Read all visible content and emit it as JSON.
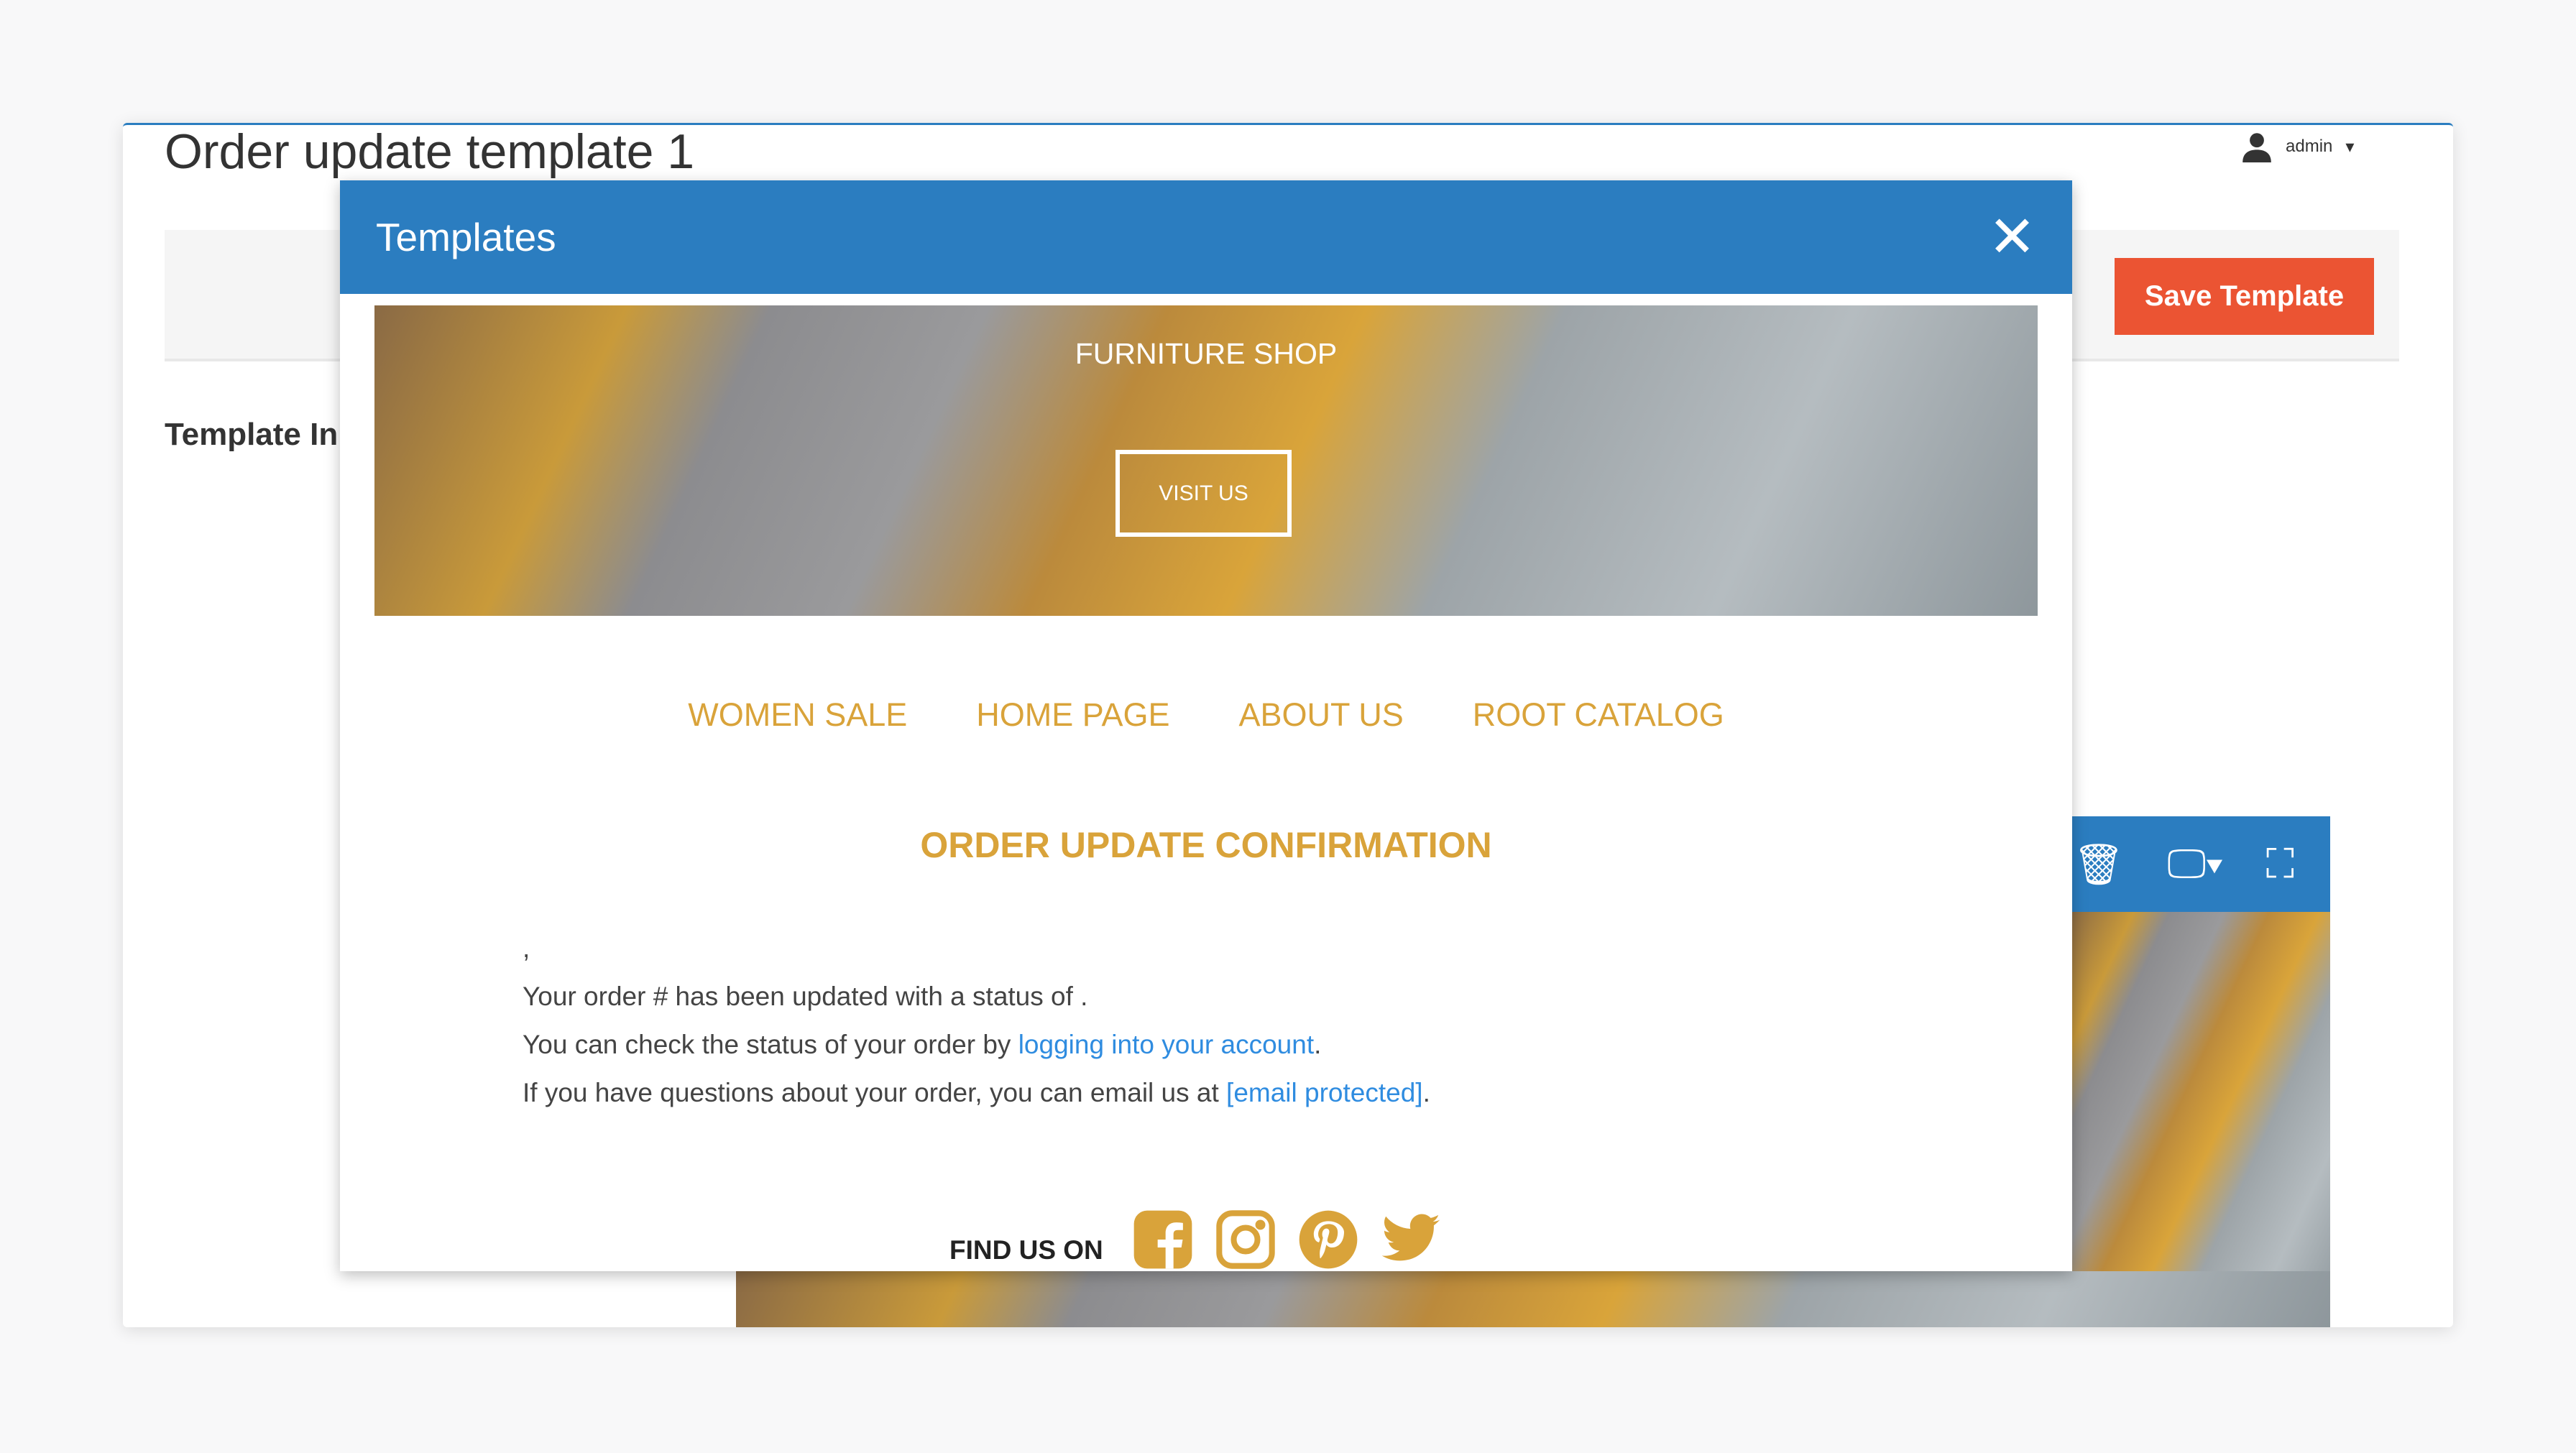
{
  "page": {
    "title": "Order update template 1",
    "user": "admin",
    "save_label": "Save Template",
    "section_label": "Template In"
  },
  "modal": {
    "title": "Templates",
    "hero": {
      "title": "FURNITURE SHOP",
      "button": "VISIT US"
    },
    "nav": [
      "WOMEN SALE",
      "HOME PAGE",
      "ABOUT US",
      "ROOT CATALOG"
    ],
    "heading": "ORDER UPDATE CONFIRMATION",
    "body": {
      "greeting": ",",
      "line1": "Your order # has been updated with a status of .",
      "line2_prefix": "You can check the status of your order by ",
      "line2_link": "logging into your account",
      "line2_suffix": ".",
      "line3_prefix": "If you have questions about your order, you can email us at ",
      "line3_link": "[email protected]",
      "line3_suffix": "."
    },
    "social": {
      "label": "FIND US ON",
      "icons": [
        "facebook-icon",
        "instagram-icon",
        "pinterest-icon",
        "twitter-icon"
      ]
    }
  },
  "colors": {
    "primary": "#2b7dc0",
    "save": "#eb5433",
    "accent": "#d9a33a",
    "link": "#2f8ce0"
  }
}
